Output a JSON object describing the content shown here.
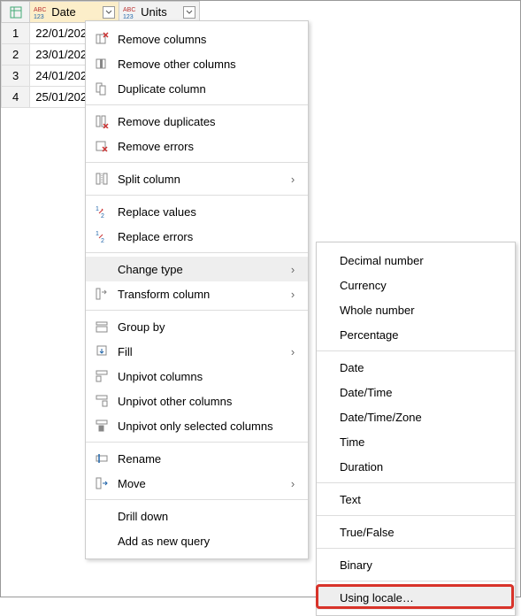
{
  "table": {
    "columns": [
      {
        "label": "Date"
      },
      {
        "label": "Units"
      }
    ],
    "rows": [
      {
        "num": "1",
        "date": "22/01/202",
        "units": ""
      },
      {
        "num": "2",
        "date": "23/01/202",
        "units": ""
      },
      {
        "num": "3",
        "date": "24/01/202",
        "units": ""
      },
      {
        "num": "4",
        "date": "25/01/202",
        "units": ""
      }
    ]
  },
  "menu1": {
    "remove_columns": "Remove columns",
    "remove_other_columns": "Remove other columns",
    "duplicate_column": "Duplicate column",
    "remove_duplicates": "Remove duplicates",
    "remove_errors": "Remove errors",
    "split_column": "Split column",
    "replace_values": "Replace values",
    "replace_errors": "Replace errors",
    "change_type": "Change type",
    "transform_column": "Transform column",
    "group_by": "Group by",
    "fill": "Fill",
    "unpivot_columns": "Unpivot columns",
    "unpivot_other_columns": "Unpivot other columns",
    "unpivot_only_selected": "Unpivot only selected columns",
    "rename": "Rename",
    "move": "Move",
    "drill_down": "Drill down",
    "add_as_new_query": "Add as new query"
  },
  "menu2": {
    "decimal_number": "Decimal number",
    "currency": "Currency",
    "whole_number": "Whole number",
    "percentage": "Percentage",
    "date": "Date",
    "date_time": "Date/Time",
    "date_time_zone": "Date/Time/Zone",
    "time": "Time",
    "duration": "Duration",
    "text": "Text",
    "true_false": "True/False",
    "binary": "Binary",
    "using_locale": "Using locale…"
  }
}
